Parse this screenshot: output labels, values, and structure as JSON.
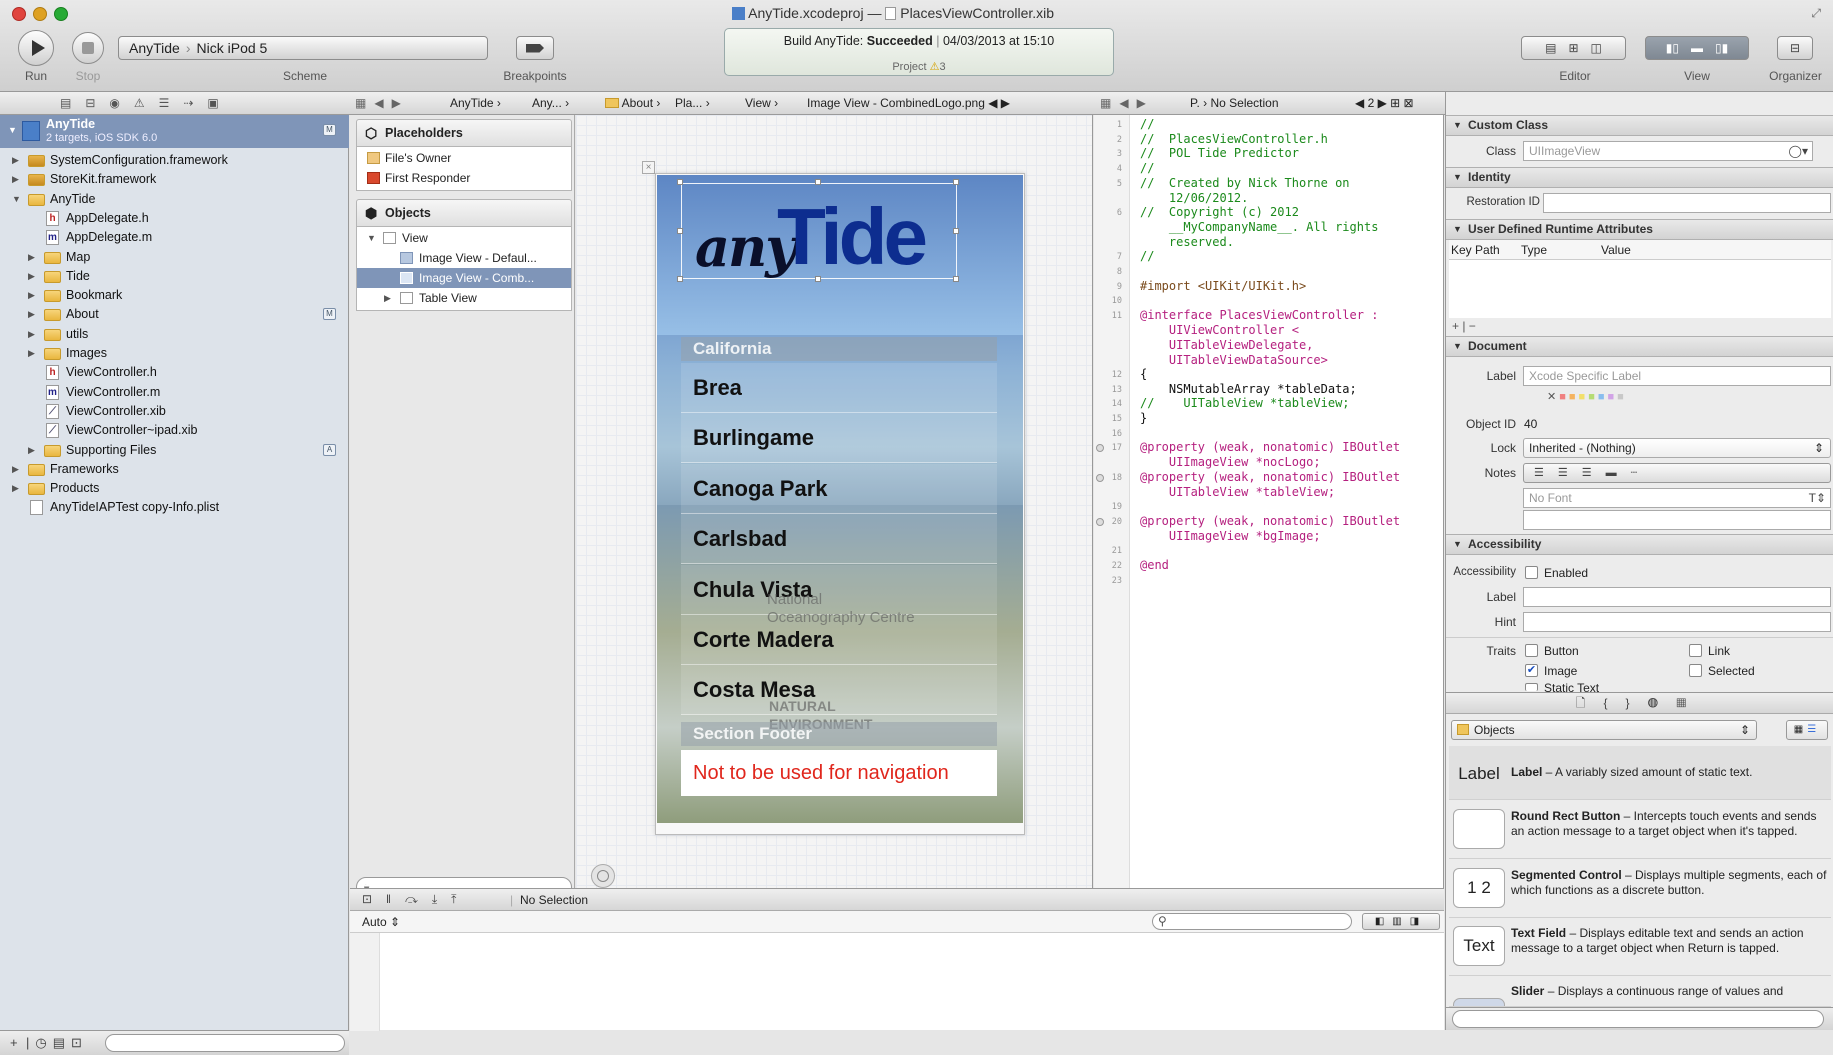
{
  "window": {
    "title_file": "AnyTide.xcodeproj",
    "title_sep": "—",
    "title_doc": "PlacesViewController.xib"
  },
  "toolbar": {
    "run_label": "Run",
    "stop_label": "Stop",
    "scheme_target": "AnyTide",
    "scheme_device": "Nick iPod 5",
    "scheme_label": "Scheme",
    "breakpoints_label": "Breakpoints",
    "editor_label": "Editor",
    "view_label": "View",
    "organizer_label": "Organizer",
    "activity": {
      "build_prefix": "Build AnyTide:",
      "build_status": "Succeeded",
      "build_time": "04/03/2013 at 15:10",
      "project_label": "Project",
      "warnings": "3"
    }
  },
  "jumpbar_left": {
    "crumbs": [
      "AnyTide",
      "Any...",
      "About",
      "Pla...",
      "View",
      "Image View - CombinedLogo.png"
    ]
  },
  "jumpbar_right": {
    "crumbs": [
      "P.",
      "No Selection"
    ],
    "counter": "2"
  },
  "navigator": {
    "project_name": "AnyTide",
    "project_sub": "2 targets, iOS SDK 6.0",
    "items": [
      {
        "label": "SystemConfiguration.framework",
        "indent": 1,
        "kind": "framework",
        "open": false
      },
      {
        "label": "StoreKit.framework",
        "indent": 1,
        "kind": "framework",
        "open": false
      },
      {
        "label": "AnyTide",
        "indent": 1,
        "kind": "folder",
        "open": true
      },
      {
        "label": "AppDelegate.h",
        "indent": 2,
        "kind": "h"
      },
      {
        "label": "AppDelegate.m",
        "indent": 2,
        "kind": "m"
      },
      {
        "label": "Map",
        "indent": 2,
        "kind": "folder",
        "open": false
      },
      {
        "label": "Tide",
        "indent": 2,
        "kind": "folder",
        "open": false
      },
      {
        "label": "Bookmark",
        "indent": 2,
        "kind": "folder",
        "open": false
      },
      {
        "label": "About",
        "indent": 2,
        "kind": "folder",
        "open": false
      },
      {
        "label": "utils",
        "indent": 2,
        "kind": "folder",
        "open": false
      },
      {
        "label": "Images",
        "indent": 2,
        "kind": "folder",
        "open": false
      },
      {
        "label": "ViewController.h",
        "indent": 2,
        "kind": "h"
      },
      {
        "label": "ViewController.m",
        "indent": 2,
        "kind": "m"
      },
      {
        "label": "ViewController.xib",
        "indent": 2,
        "kind": "xib"
      },
      {
        "label": "ViewController~ipad.xib",
        "indent": 2,
        "kind": "xib"
      },
      {
        "label": "Supporting Files",
        "indent": 2,
        "kind": "folder",
        "open": false
      },
      {
        "label": "Frameworks",
        "indent": 1,
        "kind": "folder",
        "open": false
      },
      {
        "label": "Products",
        "indent": 1,
        "kind": "folder",
        "open": false
      },
      {
        "label": "AnyTideIAPTest copy-Info.plist",
        "indent": 1,
        "kind": "plist"
      }
    ]
  },
  "outline": {
    "placeholders_title": "Placeholders",
    "files_owner": "File's Owner",
    "first_responder": "First Responder",
    "objects_title": "Objects",
    "view": "View",
    "image_view_default": "Image View - Defaul...",
    "image_view_comb": "Image View - Comb...",
    "table_view": "Table View"
  },
  "phone": {
    "logo_any": "any",
    "logo_tide": "Tide",
    "section_header": "California",
    "rows": [
      "Brea",
      "Burlingame",
      "Canoga Park",
      "Carlsbad",
      "Chula Vista",
      "Corte Madera",
      "Costa Mesa"
    ],
    "section_footer": "Section Footer",
    "footer_note": "Not to be used for navigation",
    "watermark_1": "National",
    "watermark_2": "Oceanography Centre",
    "watermark_3": "NATURAL",
    "watermark_4": "ENVIRONMENT"
  },
  "code": {
    "lines": [
      {
        "n": "1",
        "t": "//",
        "c": "cm"
      },
      {
        "n": "2",
        "t": "//  PlacesViewController.h",
        "c": "cm"
      },
      {
        "n": "3",
        "t": "//  POL Tide Predictor",
        "c": "cm"
      },
      {
        "n": "4",
        "t": "//",
        "c": "cm"
      },
      {
        "n": "5",
        "t": "//  Created by Nick Thorne on\n    12/06/2012.",
        "c": "cm"
      },
      {
        "n": "6",
        "t": "//  Copyright (c) 2012\n    __MyCompanyName__. All rights\n    reserved.",
        "c": "cm"
      },
      {
        "n": "7",
        "t": "//",
        "c": "cm"
      },
      {
        "n": "8",
        "t": "",
        "c": ""
      },
      {
        "n": "9",
        "t": "#import <UIKit/UIKit.h>",
        "c": "pp"
      },
      {
        "n": "10",
        "t": "",
        "c": ""
      },
      {
        "n": "11",
        "t": "@interface PlacesViewController :\n    UIViewController <\n    UITableViewDelegate,\n    UITableViewDataSource>",
        "c": "kw"
      },
      {
        "n": "12",
        "t": "{",
        "c": ""
      },
      {
        "n": "13",
        "t": "    NSMutableArray *tableData;",
        "c": ""
      },
      {
        "n": "14",
        "t": "//    UITableView *tableView;",
        "c": "cm"
      },
      {
        "n": "15",
        "t": "}",
        "c": ""
      },
      {
        "n": "16",
        "t": "",
        "c": ""
      },
      {
        "n": "17",
        "t": "@property (weak, nonatomic) IBOutlet\n    UIImageView *nocLogo;",
        "c": "kw"
      },
      {
        "n": "18",
        "t": "@property (weak, nonatomic) IBOutlet\n    UITableView *tableView;",
        "c": "kw"
      },
      {
        "n": "19",
        "t": "",
        "c": ""
      },
      {
        "n": "20",
        "t": "@property (weak, nonatomic) IBOutlet\n    UIImageView *bgImage;",
        "c": "kw"
      },
      {
        "n": "21",
        "t": "",
        "c": ""
      },
      {
        "n": "22",
        "t": "@end",
        "c": "kw"
      },
      {
        "n": "23",
        "t": "",
        "c": ""
      }
    ]
  },
  "debug": {
    "no_selection": "No Selection",
    "auto": "Auto"
  },
  "inspector": {
    "custom_class_title": "Custom Class",
    "class_label": "Class",
    "class_placeholder": "UIImageView",
    "identity_title": "Identity",
    "restoration_label": "Restoration ID",
    "udra_title": "User Defined Runtime Attributes",
    "col_key": "Key Path",
    "col_type": "Type",
    "col_value": "Value",
    "document_title": "Document",
    "doc_label_label": "Label",
    "doc_label_placeholder": "Xcode Specific Label",
    "object_id_label": "Object ID",
    "object_id": "40",
    "lock_label": "Lock",
    "lock_value": "Inherited - (Nothing)",
    "notes_label": "Notes",
    "font_placeholder": "No Font",
    "accessibility_title": "Accessibility",
    "acc_label": "Accessibility",
    "acc_enabled": "Enabled",
    "acc_label_label": "Label",
    "acc_hint_label": "Hint",
    "traits_label": "Traits",
    "trait_button": "Button",
    "trait_link": "Link",
    "trait_image": "Image",
    "trait_selected": "Selected",
    "trait_static": "Static Text"
  },
  "library": {
    "selector": "Objects",
    "items": [
      {
        "icon": "Label",
        "title": "Label",
        "desc": " – A variably sized amount of static text."
      },
      {
        "icon": "",
        "title": "Round Rect Button",
        "desc": " – Intercepts touch events and sends an action message to a target object when it's tapped."
      },
      {
        "icon": "1 2",
        "title": "Segmented Control",
        "desc": " – Displays multiple segments, each of which functions as a discrete button."
      },
      {
        "icon": "Text",
        "title": "Text Field",
        "desc": " – Displays editable text and sends an action message to a target object when Return is tapped."
      },
      {
        "icon": "",
        "title": "Slider",
        "desc": " – Displays a continuous range of values and"
      }
    ]
  },
  "colors": {
    "footer_red": "#e0261c",
    "selection_blue": "#7f95b8",
    "tide_blue": "#0d2d8f"
  }
}
